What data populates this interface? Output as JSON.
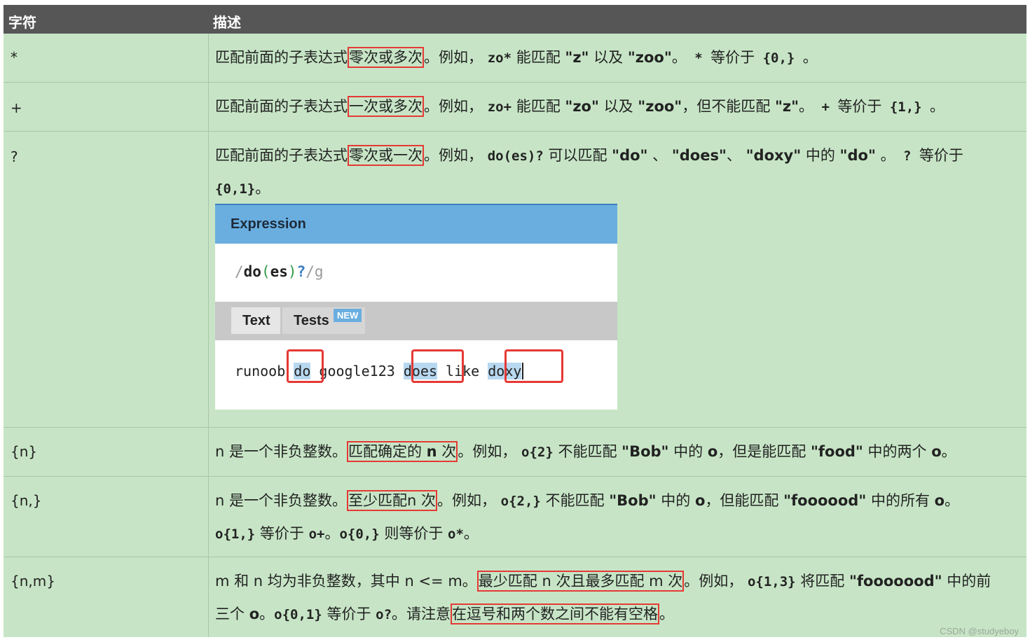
{
  "header": {
    "col1": "字符",
    "col2": "描述"
  },
  "rows": [
    {
      "sym": "*",
      "d": [
        "匹配前面的子表达式",
        "零次或多次",
        "。例如，",
        "zo*",
        " 能匹配 ",
        "\"z\"",
        " 以及 ",
        "\"zoo\"",
        "。",
        " * ",
        "等价于",
        " {0,} ",
        "。"
      ]
    },
    {
      "sym": "+",
      "d": [
        "匹配前面的子表达式",
        "一次或多次",
        "。例如，",
        "zo+",
        " 能匹配 ",
        "\"zo\"",
        " 以及 ",
        "\"zoo\"",
        "，但不能匹配 ",
        "\"z\"",
        "。",
        " + ",
        "等价于",
        " {1,} ",
        "。"
      ]
    },
    {
      "sym": "?",
      "d": [
        "匹配前面的子表达式",
        "零次或一次",
        "。例如，",
        "do(es)?",
        " 可以匹配 ",
        "\"do\"",
        " 、 ",
        "\"does\"",
        "、 ",
        "\"doxy\"",
        " 中的 ",
        "\"do\"",
        " 。",
        " ? ",
        "等价于"
      ],
      "d2": [
        "{0,1}",
        "。"
      ]
    },
    {
      "sym": "{n}",
      "d": [
        "n 是一个非负整数。",
        "匹配确定的 ",
        "n",
        " 次",
        "。例如，",
        "o{2}",
        " 不能匹配 ",
        "\"Bob\"",
        " 中的 ",
        "o",
        "，但是能匹配 ",
        "\"food\"",
        " 中的两个 ",
        "o",
        "。"
      ]
    },
    {
      "sym": "{n,}",
      "d": [
        "n 是一个非负整数。",
        "至少匹配n 次",
        "。例如，",
        "o{2,}",
        " 不能匹配 ",
        "\"Bob\"",
        " 中的 ",
        "o",
        "，但能匹配 ",
        "\"foooood\"",
        " 中的所有 ",
        "o",
        "。"
      ],
      "d2": [
        "o{1,}",
        " 等价于 ",
        "o+",
        "。",
        "o{0,}",
        " 则等价于 ",
        "o*",
        "。"
      ]
    },
    {
      "sym": "{n,m}",
      "d": [
        "m 和 n 均为非负整数，其中 n <= m。",
        "最少匹配 n 次且最多匹配 m 次",
        "。例如，",
        "o{1,3}",
        " 将匹配 ",
        "\"fooooood\"",
        " 中的前"
      ],
      "d2": [
        "三个 ",
        "o",
        "。",
        "o{0,1}",
        " 等价于 ",
        "o?",
        "。请注意",
        "在逗号和两个数之间不能有空格",
        "。"
      ]
    }
  ],
  "screenshot": {
    "title": "Expression",
    "expr_open": "/",
    "expr_do": "do",
    "expr_paren_open": "(",
    "expr_es": "es",
    "expr_paren_close": ")",
    "expr_q": "?",
    "expr_close": "/g",
    "tab_text": "Text",
    "tab_tests": "Tests",
    "badge": "NEW",
    "text_pre": "runoob ",
    "m1": "do",
    "t2": " google123 ",
    "m2": "does",
    "t3": " like ",
    "m3": "doxy"
  },
  "watermark": "CSDN @studyeboy",
  "colors": {
    "header_bg": "#565656",
    "row_bg": "#c7e5c6",
    "highlight_border": "#e53935",
    "title_bar": "#6aaee0"
  }
}
